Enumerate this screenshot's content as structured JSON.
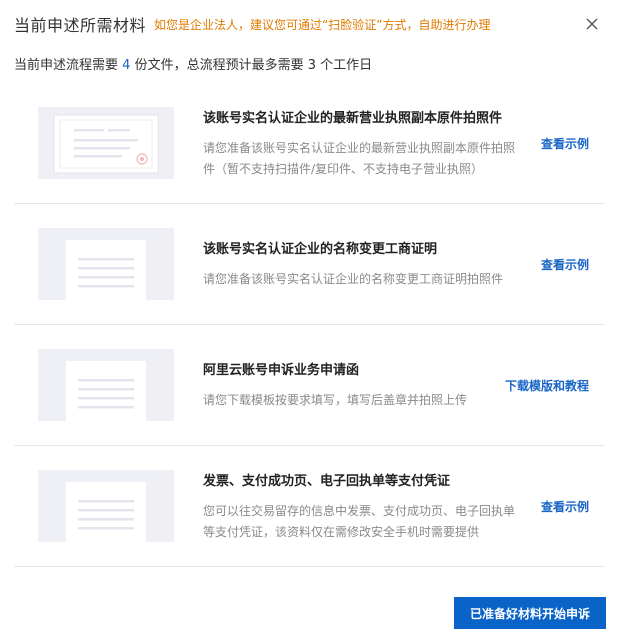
{
  "header": {
    "title": "当前申述所需材料",
    "notice": "如您是企业法人，建议您可通过“扫脸验证”方式，自助进行办理"
  },
  "summary": {
    "prefix": "当前申述流程需要",
    "file_count": "4",
    "middle": "份文件，总流程预计最多需要",
    "day_count": "3",
    "suffix": "个工作日"
  },
  "items": [
    {
      "title": "该账号实名认证企业的最新营业执照副本原件拍照件",
      "desc": "请您准备该账号实名认证企业的最新营业执照副本原件拍照件（暂不支持扫描件/复印件、不支持电子营业执照）",
      "action": "查看示例",
      "thumb_icon": "license-document-icon"
    },
    {
      "title": "该账号实名认证企业的名称变更工商证明",
      "desc": "请您准备该账号实名认证企业的名称变更工商证明拍照件",
      "action": "查看示例",
      "thumb_icon": "document-icon"
    },
    {
      "title": "阿里云账号申诉业务申请函",
      "desc": "请您下载模板按要求填写，填写后盖章并拍照上传",
      "action": "下载模版和教程",
      "thumb_icon": "document-icon"
    },
    {
      "title": "发票、支付成功页、电子回执单等支付凭证",
      "desc": "您可以往交易留存的信息中发票、支付成功页、电子回执单等支付凭证，该资料仅在需修改安全手机时需要提供",
      "action": "查看示例",
      "thumb_icon": "document-icon"
    }
  ],
  "footer": {
    "submit_label": "已准备好材料开始申诉"
  },
  "colors": {
    "accent": "#0a64c8",
    "link": "#1a66c7",
    "notice": "#e07a00",
    "thumb_bg": "#eef0f5"
  }
}
